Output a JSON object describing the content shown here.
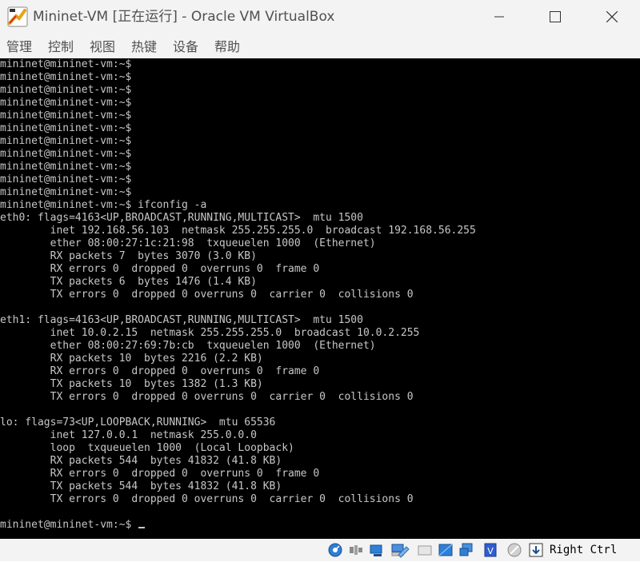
{
  "window": {
    "title": "Mininet-VM [正在运行] - Oracle VM VirtualBox"
  },
  "menu": {
    "items": [
      {
        "label": "管理"
      },
      {
        "label": "控制"
      },
      {
        "label": "视图"
      },
      {
        "label": "热键"
      },
      {
        "label": "设备"
      },
      {
        "label": "帮助"
      }
    ]
  },
  "console": {
    "lines": [
      "mininet@mininet-vm:~$",
      "mininet@mininet-vm:~$",
      "mininet@mininet-vm:~$",
      "mininet@mininet-vm:~$",
      "mininet@mininet-vm:~$",
      "mininet@mininet-vm:~$",
      "mininet@mininet-vm:~$",
      "mininet@mininet-vm:~$",
      "mininet@mininet-vm:~$",
      "mininet@mininet-vm:~$",
      "mininet@mininet-vm:~$",
      "mininet@mininet-vm:~$ ifconfig -a",
      "eth0: flags=4163<UP,BROADCAST,RUNNING,MULTICAST>  mtu 1500",
      "        inet 192.168.56.103  netmask 255.255.255.0  broadcast 192.168.56.255",
      "        ether 08:00:27:1c:21:98  txqueuelen 1000  (Ethernet)",
      "        RX packets 7  bytes 3070 (3.0 KB)",
      "        RX errors 0  dropped 0  overruns 0  frame 0",
      "        TX packets 6  bytes 1476 (1.4 KB)",
      "        TX errors 0  dropped 0 overruns 0  carrier 0  collisions 0",
      "",
      "eth1: flags=4163<UP,BROADCAST,RUNNING,MULTICAST>  mtu 1500",
      "        inet 10.0.2.15  netmask 255.255.255.0  broadcast 10.0.2.255",
      "        ether 08:00:27:69:7b:cb  txqueuelen 1000  (Ethernet)",
      "        RX packets 10  bytes 2216 (2.2 KB)",
      "        RX errors 0  dropped 0  overruns 0  frame 0",
      "        TX packets 10  bytes 1382 (1.3 KB)",
      "        TX errors 0  dropped 0 overruns 0  carrier 0  collisions 0",
      "",
      "lo: flags=73<UP,LOOPBACK,RUNNING>  mtu 65536",
      "        inet 127.0.0.1  netmask 255.0.0.0",
      "        loop  txqueuelen 1000  (Local Loopback)",
      "        RX packets 544  bytes 41832 (41.8 KB)",
      "        RX errors 0  dropped 0  overruns 0  frame 0",
      "        TX packets 544  bytes 41832 (41.8 KB)",
      "        TX errors 0  dropped 0 overruns 0  carrier 0  collisions 0",
      "",
      "mininet@mininet-vm:~$"
    ]
  },
  "statusbar": {
    "host_key": "Right Ctrl",
    "icons": [
      "hard-disk-icon",
      "optical-drive-icon",
      "audio-icon",
      "network-icon",
      "usb-icon",
      "shared-folder-icon",
      "display-icon",
      "video-capture-icon",
      "cpu-virtualization-icon",
      "mouse-integration-icon",
      "keyboard-capture-icon"
    ]
  },
  "colors": {
    "console_bg": "#000000",
    "console_text": "#c7c7c7",
    "chrome_bg": "#f3f3f3"
  }
}
